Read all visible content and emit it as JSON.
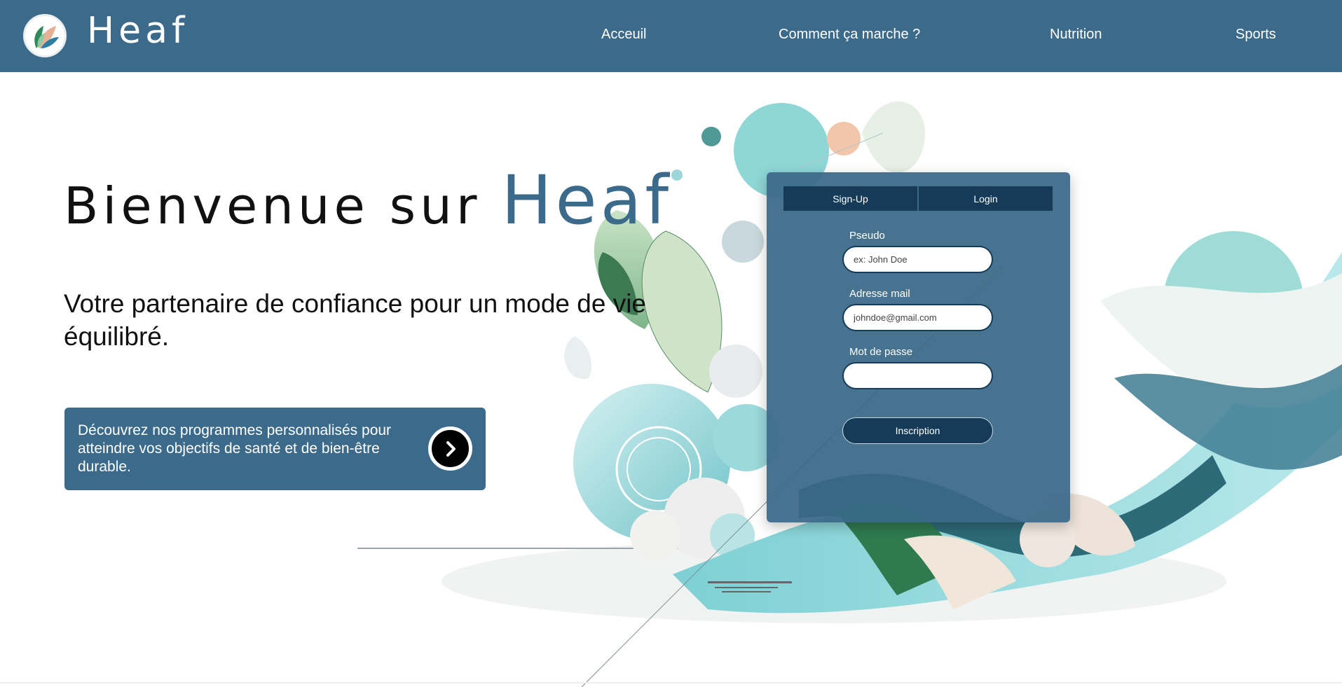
{
  "header": {
    "brand": "Heaf",
    "logo": "leaf-logo",
    "nav": [
      {
        "label": "Acceuil"
      },
      {
        "label": "Comment ça marche ?"
      },
      {
        "label": "Nutrition"
      },
      {
        "label": "Sports"
      }
    ]
  },
  "hero": {
    "title_prefix": "Bienvenue sur ",
    "title_brand": "Heaf",
    "subtitle": "Votre partenaire de confiance pour un mode de vie équilibré.",
    "cta_text": "Découvrez nos programmes personnalisés pour atteindre vos objectifs de santé et de bien-être durable.",
    "cta_icon": "chevron-right-icon"
  },
  "form": {
    "tabs": [
      {
        "label": "Sign-Up"
      },
      {
        "label": "Login"
      }
    ],
    "pseudo_label": "Pseudo",
    "pseudo_placeholder": "ex: John Doe",
    "email_label": "Adresse mail",
    "email_placeholder": "johndoe@gmail.com",
    "password_label": "Mot de passe",
    "password_value": "",
    "submit_label": "Inscription"
  },
  "colors": {
    "primary": "#3c6a8a",
    "dark": "#153b58",
    "mint": "#8fd3d6",
    "green": "#3d7a52"
  }
}
